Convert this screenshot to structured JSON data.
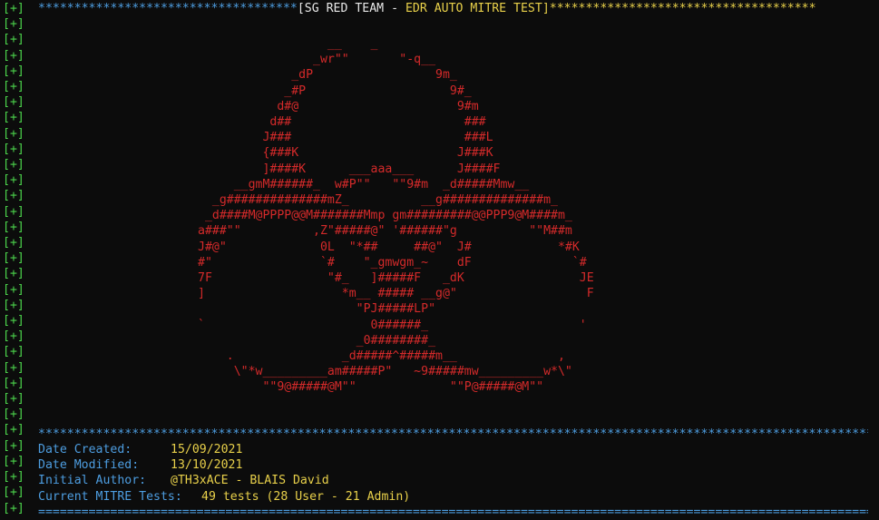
{
  "prompt_marker": "[+]",
  "banner": {
    "stars_left": "************************************",
    "open": "[",
    "team": "SG RED TEAM",
    "dash": " - ",
    "title": "EDR AUTO MITRE TEST",
    "close": "]",
    "stars_right": "*************************************"
  },
  "art_lines": [
    "                  __    _",
    "                _wr\"\"       \"-q__",
    "             _dP                 9m_",
    "            _#P                    9#_",
    "           d#@                      9#m",
    "          d##                        ###",
    "         J###                        ###L",
    "         {###K                      J###K",
    "         ]####K      ___aaa___      J####F",
    "     __gmM######_  w#P\"\"   \"\"9#m  _d#####Mmw__",
    "  _g##############mZ_          __g##############m_",
    " _d####M@PPPP@@M#######Mmp gm#########@@PPP9@M####m_",
    "a###\"\"          ,Z\"#####@\" '######\"g          \"\"M##m",
    "J#@\"             0L  \"*##     ##@\"  J#            *#K",
    "#\"               `#    \"_gmwgm_~    dF              `#",
    "7F                \"#_   ]#####F   _dK                JE",
    "]                   *m__ ##### __g@\"                  F",
    "                      \"PJ#####LP\"",
    "`                       0######_                     '",
    "                      _0########_",
    "    .               _d#####^#####m__              ,",
    "     \\\"*w_________am#####P\"   ~9#####mw_________w*\\\"",
    "         \"\"9@#####@M\"\"             \"\"P@#####@M\"\""
  ],
  "separator_stars": "*****************************************************************************************************************************",
  "separator_equals": "=============================================================================================================================",
  "info": {
    "date_created_label": "Date Created:",
    "date_created": "15/09/2021",
    "date_modified_label": "Date Modified:",
    "date_modified": "13/10/2021",
    "author_label": "Initial Author:",
    "author": "@TH3xACE - BLAIS David",
    "tests_label": "Current MITRE Tests:",
    "tests": "49 tests (28 User - 21 Admin)"
  }
}
